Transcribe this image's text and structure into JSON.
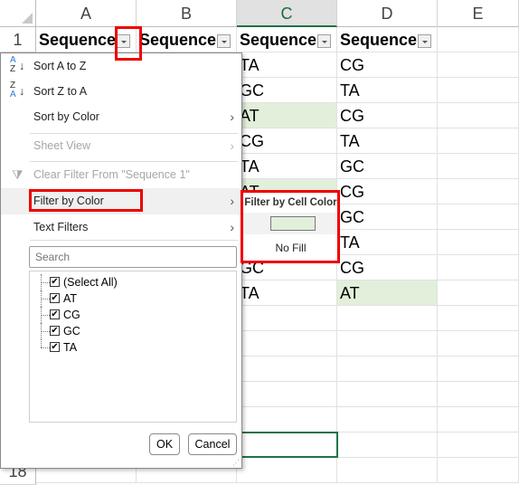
{
  "columns": [
    "A",
    "B",
    "C",
    "D",
    "E"
  ],
  "selected_column": "C",
  "rows": [
    "1",
    "18"
  ],
  "header_row": [
    "Sequence 1",
    "Sequence",
    "Sequence",
    "Sequence"
  ],
  "header_display": "Sequence",
  "column_c": [
    "TA",
    "GC",
    "AT",
    "CG",
    "TA",
    "AT",
    "GC",
    "TA",
    "GC",
    "TA"
  ],
  "column_d": [
    "CG",
    "TA",
    "CG",
    "TA",
    "GC",
    "CG",
    "GC",
    "TA",
    "CG",
    "AT"
  ],
  "green_cells": [
    "C4",
    "C7",
    "D11"
  ],
  "colors": {
    "green_fill": "#e2efda",
    "highlight": "#ee0000",
    "selection": "#217346"
  },
  "menu": {
    "sort_az": "Sort A to Z",
    "sort_za": "Sort Z to A",
    "sort_color": "Sort by Color",
    "sheet_view": "Sheet View",
    "clear_filter": "Clear Filter From \"Sequence 1\"",
    "filter_color": "Filter by Color",
    "text_filters": "Text Filters",
    "search_placeholder": "Search",
    "list": [
      "(Select All)",
      "AT",
      "CG",
      "GC",
      "TA"
    ],
    "ok": "OK",
    "cancel": "Cancel"
  },
  "submenu": {
    "title": "Filter by Cell Color",
    "no_fill": "No Fill",
    "swatch_color": "#e2efda"
  }
}
